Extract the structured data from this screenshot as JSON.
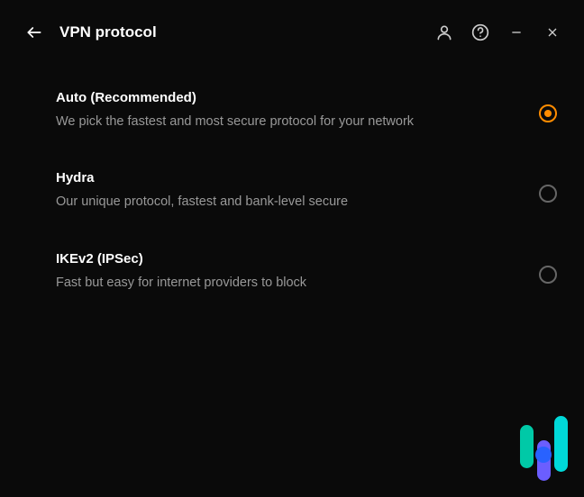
{
  "header": {
    "title": "VPN protocol"
  },
  "protocols": [
    {
      "title": "Auto (Recommended)",
      "description": "We pick the fastest and most secure protocol for your network",
      "selected": true
    },
    {
      "title": "Hydra",
      "description": "Our unique protocol, fastest and bank-level secure",
      "selected": false
    },
    {
      "title": "IKEv2 (IPSec)",
      "description": "Fast but easy for internet providers to block",
      "selected": false
    }
  ]
}
